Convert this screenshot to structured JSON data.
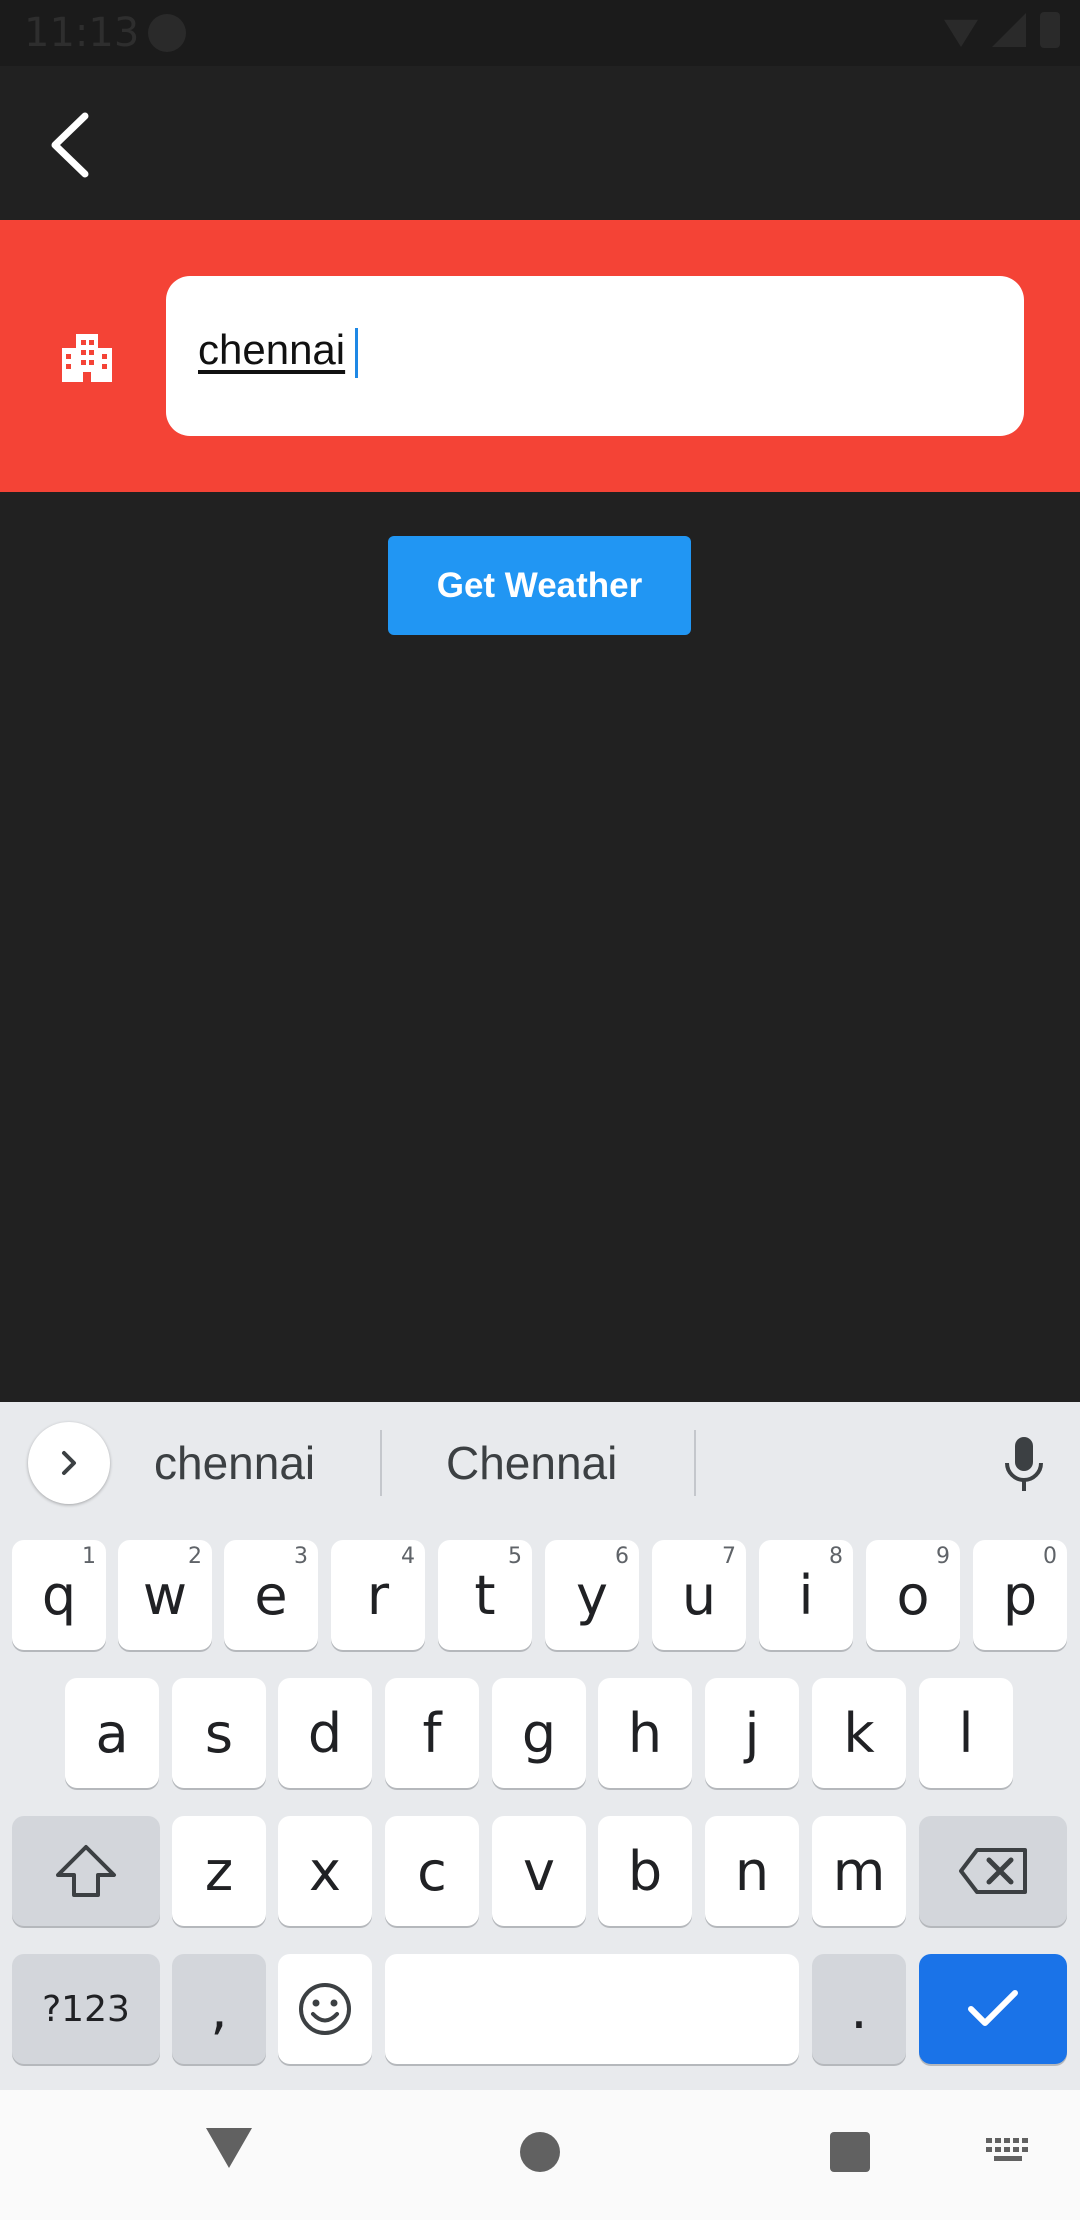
{
  "status_bar": {
    "time": "11:13"
  },
  "app_bar": {
    "back_icon": "arrow-back-icon"
  },
  "search": {
    "icon": "city-icon",
    "value": "chennai",
    "accent_color": "#f44336"
  },
  "actions": {
    "get_weather_label": "Get Weather",
    "button_color": "#2196f3"
  },
  "keyboard": {
    "suggestions": [
      "chennai",
      "Chennai"
    ],
    "row1": [
      {
        "k": "q",
        "h": "1"
      },
      {
        "k": "w",
        "h": "2"
      },
      {
        "k": "e",
        "h": "3"
      },
      {
        "k": "r",
        "h": "4"
      },
      {
        "k": "t",
        "h": "5"
      },
      {
        "k": "y",
        "h": "6"
      },
      {
        "k": "u",
        "h": "7"
      },
      {
        "k": "i",
        "h": "8"
      },
      {
        "k": "o",
        "h": "9"
      },
      {
        "k": "p",
        "h": "0"
      }
    ],
    "row2": [
      "a",
      "s",
      "d",
      "f",
      "g",
      "h",
      "j",
      "k",
      "l"
    ],
    "row3": [
      "z",
      "x",
      "c",
      "v",
      "b",
      "n",
      "m"
    ],
    "symbols_label": "?123",
    "comma": ",",
    "period": ".",
    "enter_color": "#1a73e8"
  },
  "nav_bar": {
    "icons": [
      "back-triangle-icon",
      "home-circle-icon",
      "recents-square-icon",
      "keyboard-switch-icon"
    ]
  }
}
